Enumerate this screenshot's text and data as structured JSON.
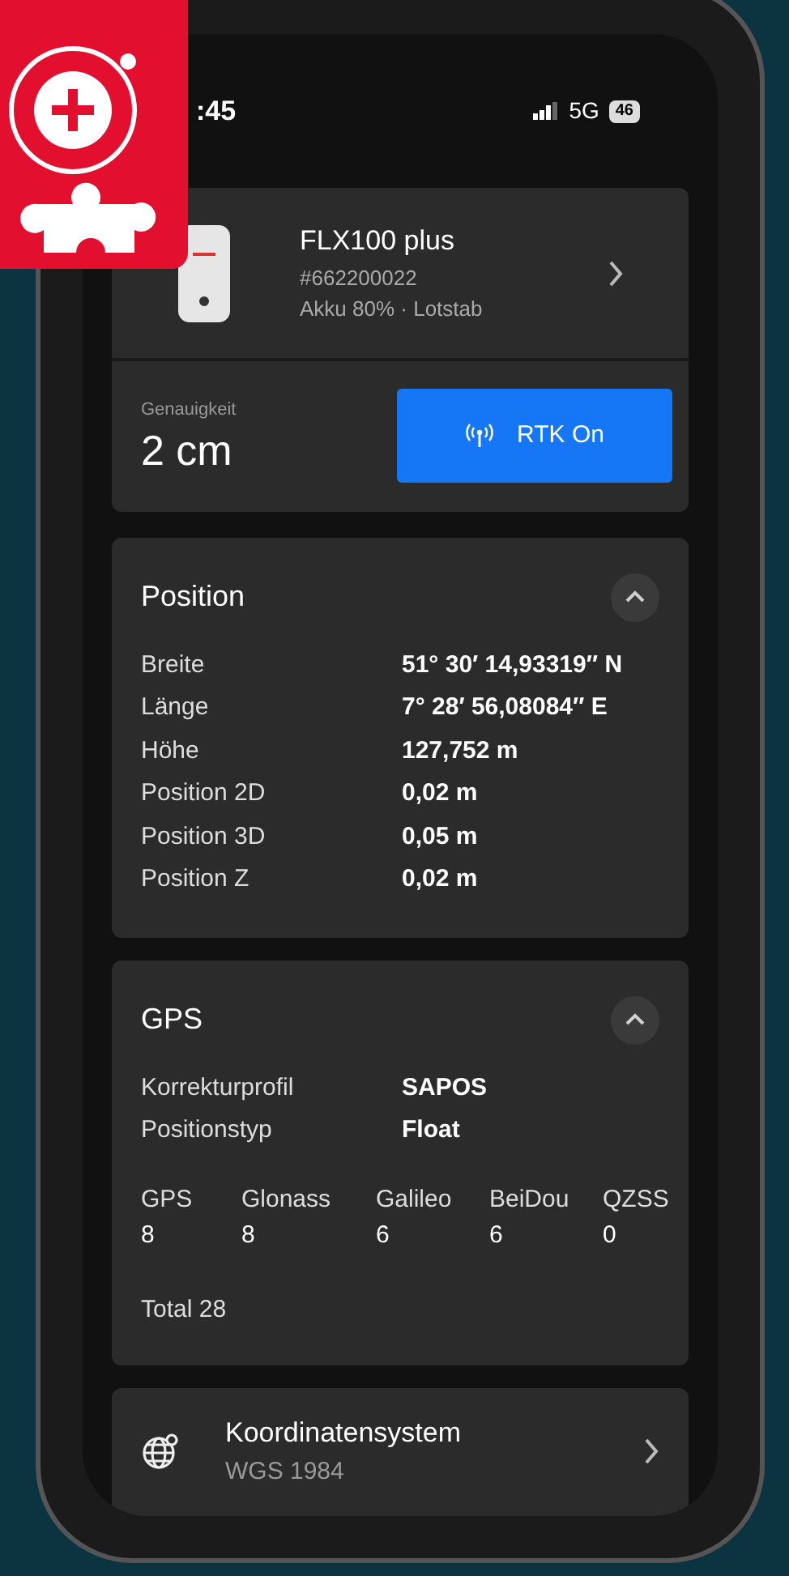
{
  "status_bar": {
    "time": ":45",
    "network": "5G",
    "battery": "46"
  },
  "device": {
    "name": "FLX100 plus",
    "serial": "#662200022",
    "details": "Akku 80% · Lotstab"
  },
  "accuracy": {
    "label": "Genauigkeit",
    "value": "2 cm",
    "rtk_button": "RTK On"
  },
  "position": {
    "title": "Position",
    "expanded": true,
    "rows": [
      {
        "label": "Breite",
        "value": "51° 30′ 14,93319″ N"
      },
      {
        "label": "Länge",
        "value": "7° 28′ 56,08084″ E"
      },
      {
        "label": "Höhe",
        "value": "127,752 m"
      },
      {
        "label": "Position 2D",
        "value": "0,02 m"
      },
      {
        "label": "Position 3D",
        "value": "0,05 m"
      },
      {
        "label": "Position Z",
        "value": "0,02 m"
      }
    ]
  },
  "gps": {
    "title": "GPS",
    "expanded": true,
    "rows": [
      {
        "label": "Korrekturprofil",
        "value": "SAPOS"
      },
      {
        "label": "Positionstyp",
        "value": "Float"
      }
    ],
    "satellites": [
      {
        "name": "GPS",
        "count": "8"
      },
      {
        "name": "Glonass",
        "count": "8"
      },
      {
        "name": "Galileo",
        "count": "6"
      },
      {
        "name": "BeiDou",
        "count": "6"
      },
      {
        "name": "QZSS",
        "count": "0"
      }
    ],
    "total": "Total 28"
  },
  "coordinate_system": {
    "title": "Koordinatensystem",
    "value": "WGS 1984"
  }
}
